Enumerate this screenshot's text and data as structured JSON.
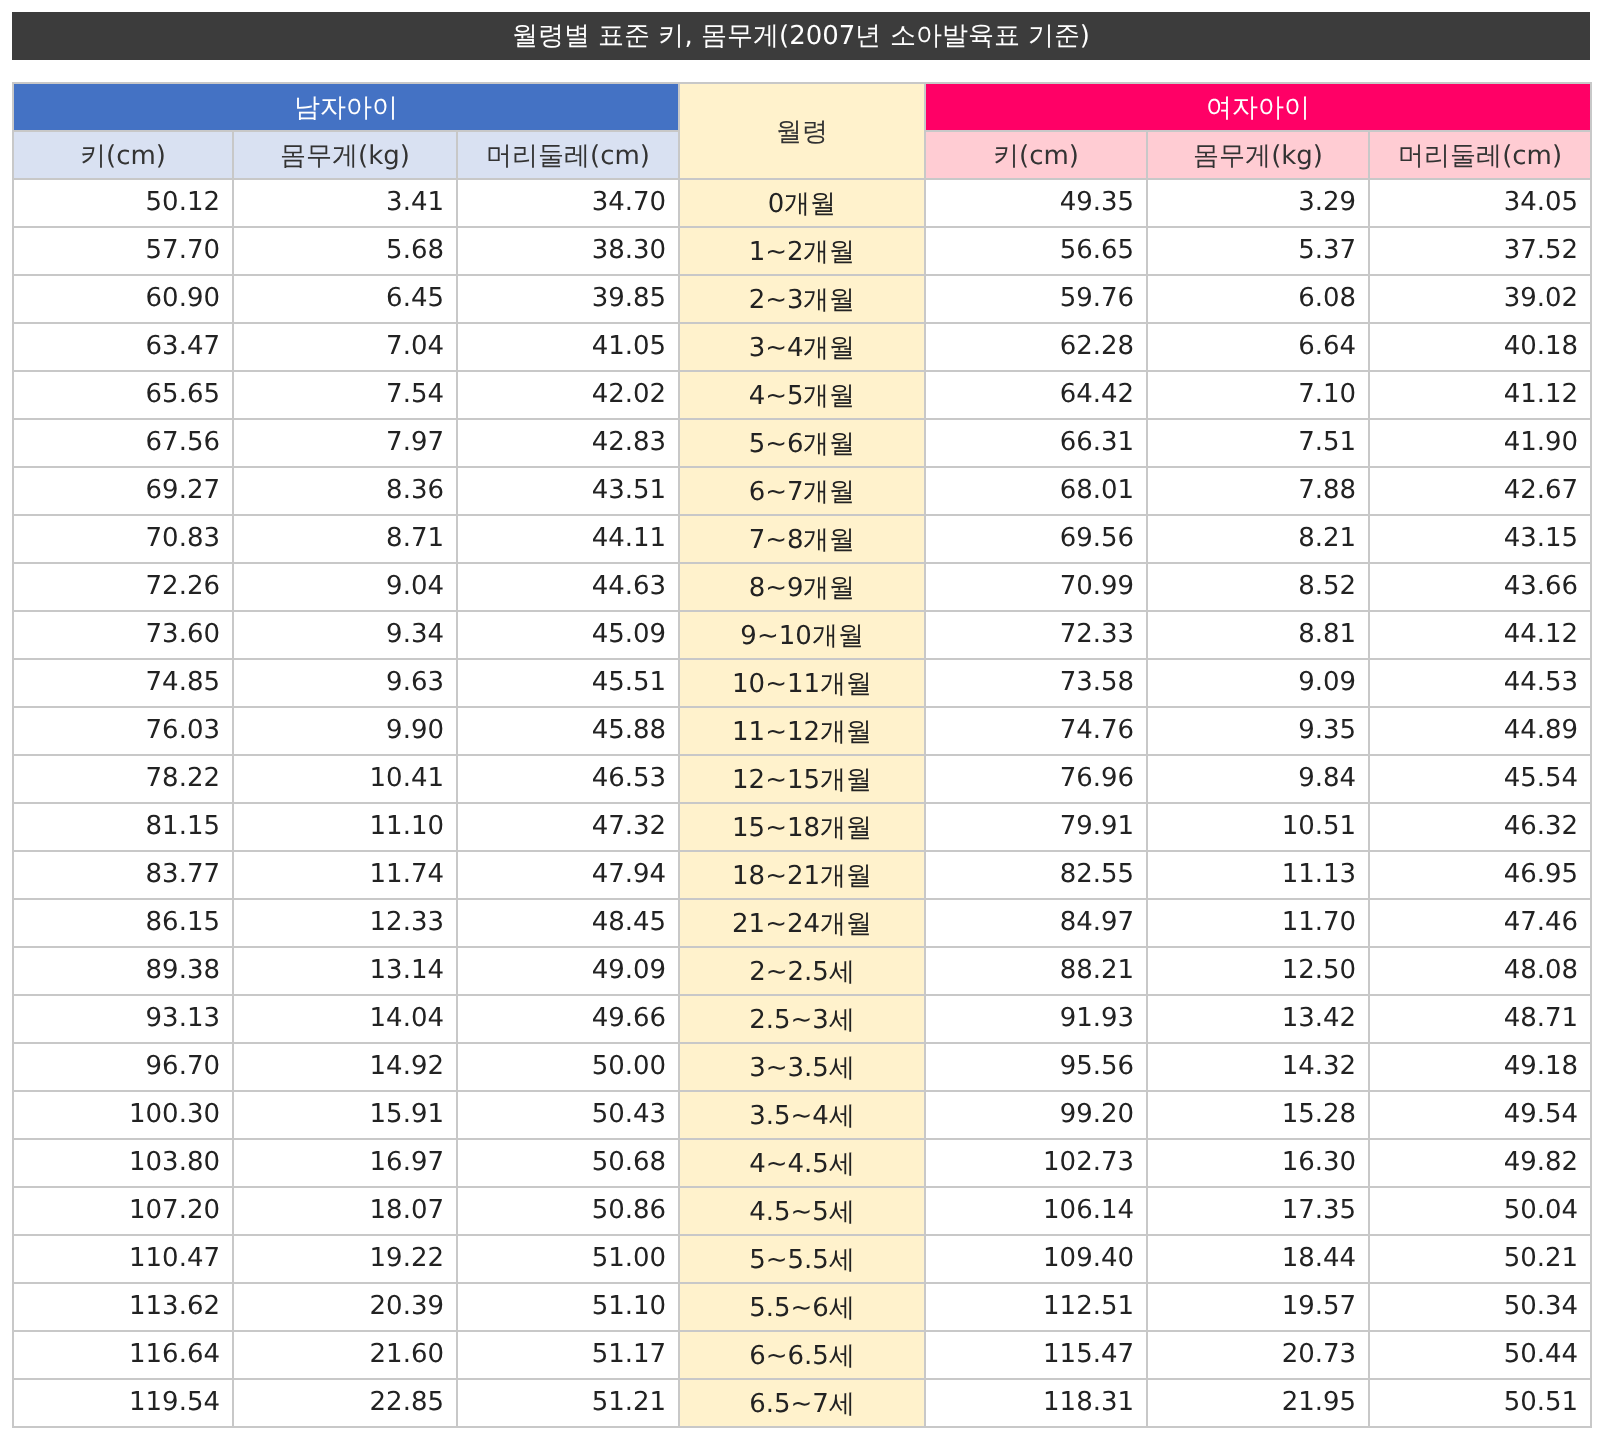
{
  "title": "월령별 표준 키, 몸무게(2007년 소아발육표 기준)",
  "groups": {
    "boy": "남자아이",
    "age": "월령",
    "girl": "여자아이"
  },
  "columns": {
    "boy": [
      "키(cm)",
      "몸무게(kg)",
      "머리둘레(cm)"
    ],
    "girl": [
      "키(cm)",
      "몸무게(kg)",
      "머리둘레(cm)"
    ]
  },
  "rows": [
    {
      "age": "0개월",
      "boy": [
        "50.12",
        "3.41",
        "34.70"
      ],
      "girl": [
        "49.35",
        "3.29",
        "34.05"
      ]
    },
    {
      "age": "1~2개월",
      "boy": [
        "57.70",
        "5.68",
        "38.30"
      ],
      "girl": [
        "56.65",
        "5.37",
        "37.52"
      ]
    },
    {
      "age": "2~3개월",
      "boy": [
        "60.90",
        "6.45",
        "39.85"
      ],
      "girl": [
        "59.76",
        "6.08",
        "39.02"
      ]
    },
    {
      "age": "3~4개월",
      "boy": [
        "63.47",
        "7.04",
        "41.05"
      ],
      "girl": [
        "62.28",
        "6.64",
        "40.18"
      ]
    },
    {
      "age": "4~5개월",
      "boy": [
        "65.65",
        "7.54",
        "42.02"
      ],
      "girl": [
        "64.42",
        "7.10",
        "41.12"
      ]
    },
    {
      "age": "5~6개월",
      "boy": [
        "67.56",
        "7.97",
        "42.83"
      ],
      "girl": [
        "66.31",
        "7.51",
        "41.90"
      ]
    },
    {
      "age": "6~7개월",
      "boy": [
        "69.27",
        "8.36",
        "43.51"
      ],
      "girl": [
        "68.01",
        "7.88",
        "42.67"
      ]
    },
    {
      "age": "7~8개월",
      "boy": [
        "70.83",
        "8.71",
        "44.11"
      ],
      "girl": [
        "69.56",
        "8.21",
        "43.15"
      ]
    },
    {
      "age": "8~9개월",
      "boy": [
        "72.26",
        "9.04",
        "44.63"
      ],
      "girl": [
        "70.99",
        "8.52",
        "43.66"
      ]
    },
    {
      "age": "9~10개월",
      "boy": [
        "73.60",
        "9.34",
        "45.09"
      ],
      "girl": [
        "72.33",
        "8.81",
        "44.12"
      ]
    },
    {
      "age": "10~11개월",
      "boy": [
        "74.85",
        "9.63",
        "45.51"
      ],
      "girl": [
        "73.58",
        "9.09",
        "44.53"
      ]
    },
    {
      "age": "11~12개월",
      "boy": [
        "76.03",
        "9.90",
        "45.88"
      ],
      "girl": [
        "74.76",
        "9.35",
        "44.89"
      ]
    },
    {
      "age": "12~15개월",
      "boy": [
        "78.22",
        "10.41",
        "46.53"
      ],
      "girl": [
        "76.96",
        "9.84",
        "45.54"
      ]
    },
    {
      "age": "15~18개월",
      "boy": [
        "81.15",
        "11.10",
        "47.32"
      ],
      "girl": [
        "79.91",
        "10.51",
        "46.32"
      ]
    },
    {
      "age": "18~21개월",
      "boy": [
        "83.77",
        "11.74",
        "47.94"
      ],
      "girl": [
        "82.55",
        "11.13",
        "46.95"
      ]
    },
    {
      "age": "21~24개월",
      "boy": [
        "86.15",
        "12.33",
        "48.45"
      ],
      "girl": [
        "84.97",
        "11.70",
        "47.46"
      ]
    },
    {
      "age": "2~2.5세",
      "boy": [
        "89.38",
        "13.14",
        "49.09"
      ],
      "girl": [
        "88.21",
        "12.50",
        "48.08"
      ]
    },
    {
      "age": "2.5~3세",
      "boy": [
        "93.13",
        "14.04",
        "49.66"
      ],
      "girl": [
        "91.93",
        "13.42",
        "48.71"
      ]
    },
    {
      "age": "3~3.5세",
      "boy": [
        "96.70",
        "14.92",
        "50.00"
      ],
      "girl": [
        "95.56",
        "14.32",
        "49.18"
      ]
    },
    {
      "age": "3.5~4세",
      "boy": [
        "100.30",
        "15.91",
        "50.43"
      ],
      "girl": [
        "99.20",
        "15.28",
        "49.54"
      ]
    },
    {
      "age": "4~4.5세",
      "boy": [
        "103.80",
        "16.97",
        "50.68"
      ],
      "girl": [
        "102.73",
        "16.30",
        "49.82"
      ]
    },
    {
      "age": "4.5~5세",
      "boy": [
        "107.20",
        "18.07",
        "50.86"
      ],
      "girl": [
        "106.14",
        "17.35",
        "50.04"
      ]
    },
    {
      "age": "5~5.5세",
      "boy": [
        "110.47",
        "19.22",
        "51.00"
      ],
      "girl": [
        "109.40",
        "18.44",
        "50.21"
      ]
    },
    {
      "age": "5.5~6세",
      "boy": [
        "113.62",
        "20.39",
        "51.10"
      ],
      "girl": [
        "112.51",
        "19.57",
        "50.34"
      ]
    },
    {
      "age": "6~6.5세",
      "boy": [
        "116.64",
        "21.60",
        "51.17"
      ],
      "girl": [
        "115.47",
        "20.73",
        "50.44"
      ]
    },
    {
      "age": "6.5~7세",
      "boy": [
        "119.54",
        "22.85",
        "51.21"
      ],
      "girl": [
        "118.31",
        "21.95",
        "50.51"
      ]
    }
  ]
}
